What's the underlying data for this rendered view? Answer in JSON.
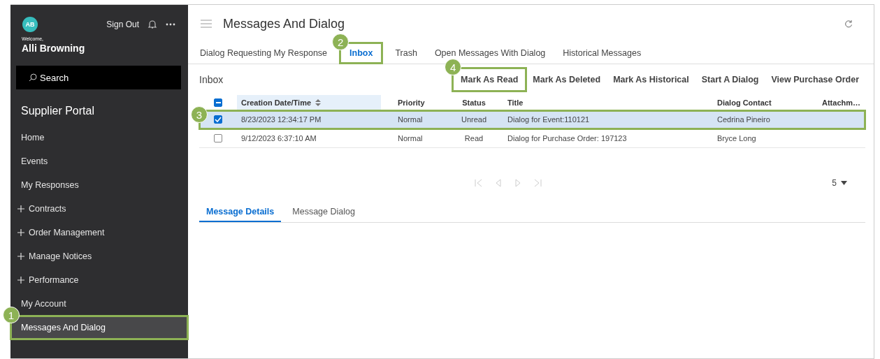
{
  "sidebar": {
    "user": {
      "initials": "AB",
      "welcome": "Welcome,",
      "name": "Alli Browning"
    },
    "sign_out": "Sign Out",
    "search": {
      "placeholder": "Search"
    },
    "portal_title": "Supplier Portal",
    "items": [
      {
        "label": "Home",
        "expandable": false,
        "selected": false
      },
      {
        "label": "Events",
        "expandable": false,
        "selected": false
      },
      {
        "label": "My Responses",
        "expandable": false,
        "selected": false
      },
      {
        "label": "Contracts",
        "expandable": true,
        "selected": false
      },
      {
        "label": "Order Management",
        "expandable": true,
        "selected": false
      },
      {
        "label": "Manage Notices",
        "expandable": true,
        "selected": false
      },
      {
        "label": "Performance",
        "expandable": true,
        "selected": false
      },
      {
        "label": "My Account",
        "expandable": false,
        "selected": false
      },
      {
        "label": "Messages And Dialog",
        "expandable": false,
        "selected": true,
        "callout": "1"
      }
    ]
  },
  "page": {
    "title": "Messages And Dialog"
  },
  "tabs": [
    {
      "label": "Dialog Requesting My Response",
      "selected": false
    },
    {
      "label": "Inbox",
      "selected": true,
      "callout": "2"
    },
    {
      "label": "Trash",
      "selected": false
    },
    {
      "label": "Open Messages With Dialog",
      "selected": false
    },
    {
      "label": "Historical Messages",
      "selected": false
    }
  ],
  "inbox": {
    "title": "Inbox",
    "actions": [
      {
        "label": "Mark As Read",
        "callout": "4"
      },
      {
        "label": "Mark As Deleted"
      },
      {
        "label": "Mark As Historical"
      },
      {
        "label": "Start A Dialog"
      },
      {
        "label": "View Purchase Order"
      }
    ]
  },
  "table": {
    "select_all_indeterminate": true,
    "columns": [
      "Creation Date/Time",
      "Priority",
      "Status",
      "Title",
      "Dialog Contact",
      "Attachm…"
    ],
    "rows": [
      {
        "selected": true,
        "checked": true,
        "callout": "3",
        "cells": [
          "8/23/2023 12:34:17 PM",
          "Normal",
          "Unread",
          "Dialog for Event:110121",
          "Cedrina Pineiro"
        ]
      },
      {
        "selected": false,
        "checked": false,
        "cells": [
          "9/12/2023 6:37:10 AM",
          "Normal",
          "Read",
          "Dialog for Purchase Order: 197123",
          "Bryce Long"
        ]
      }
    ]
  },
  "pagination": {
    "page_size": "5"
  },
  "detail_tabs": [
    {
      "label": "Message Details",
      "selected": true
    },
    {
      "label": "Message Dialog",
      "selected": false
    }
  ]
}
